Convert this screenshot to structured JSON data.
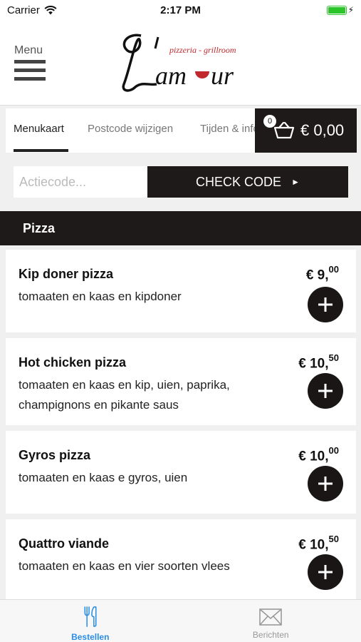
{
  "status_bar": {
    "carrier": "Carrier",
    "time": "2:17 PM"
  },
  "header": {
    "menu_label": "Menu",
    "logo_text": "L'amour",
    "logo_subtitle": "pizzeria - grillroom"
  },
  "tabs": [
    {
      "label": "Menukaart",
      "active": true
    },
    {
      "label": "Postcode wijzigen",
      "active": false
    },
    {
      "label": "Tijden & info",
      "active": false
    }
  ],
  "cart": {
    "count": "0",
    "total": "€ 0,00"
  },
  "promo": {
    "placeholder": "Actiecode...",
    "button_label": "CHECK CODE"
  },
  "category": {
    "title": "Pizza"
  },
  "products": [
    {
      "name": "Kip doner pizza",
      "description": "tomaaten en kaas en kipdoner",
      "price_main": "€ 9,",
      "price_cents": "00"
    },
    {
      "name": "Hot chicken pizza",
      "description": "tomaaten en kaas en kip, uien, paprika, champignons en pikante saus",
      "price_main": "€ 10,",
      "price_cents": "50"
    },
    {
      "name": "Gyros pizza",
      "description": "tomaaten en kaas e gyros, uien",
      "price_main": "€ 10,",
      "price_cents": "00"
    },
    {
      "name": "Quattro viande",
      "description": "tomaaten en kaas en vier soorten vlees",
      "price_main": "€ 10,",
      "price_cents": "50"
    }
  ],
  "tabbar": [
    {
      "label": "Bestellen",
      "icon": "fork-knife-icon",
      "active": true
    },
    {
      "label": "Berichten",
      "icon": "envelope-icon",
      "active": false
    }
  ],
  "colors": {
    "dark": "#1e1a1a",
    "accent_blue": "#2a8ee8",
    "battery_green": "#2bc52b",
    "logo_red": "#c0282d"
  }
}
